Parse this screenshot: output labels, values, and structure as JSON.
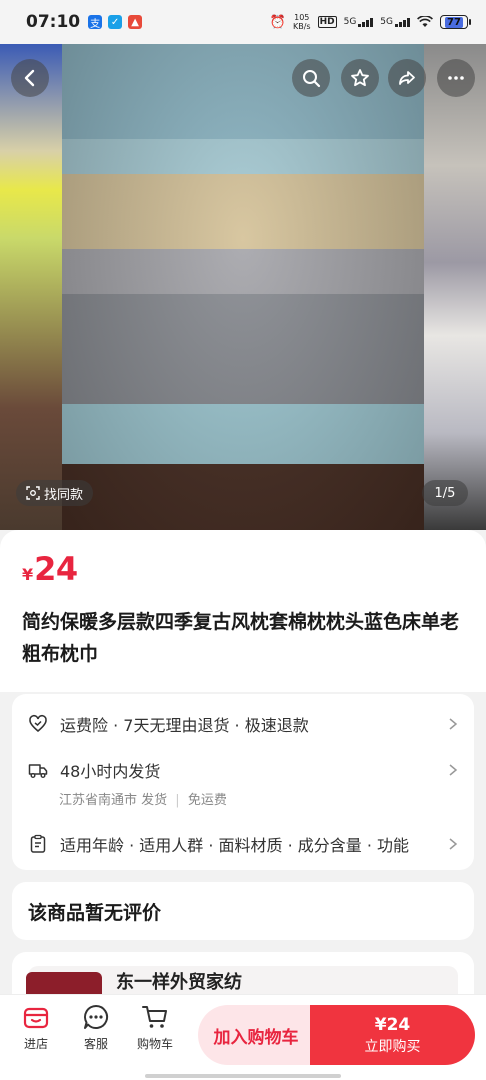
{
  "status_bar": {
    "time": "07:10",
    "speed_value": "105",
    "speed_unit": "KB/s",
    "hd_label": "HD",
    "signal1": "5G",
    "signal2": "5G",
    "battery": "77"
  },
  "gallery": {
    "find_similar_label": "找同款",
    "page_indicator": "1/5"
  },
  "product": {
    "currency": "¥",
    "price": "24",
    "title": "简约保暖多层款四季复古风枕套棉枕枕头蓝色床单老粗布枕巾"
  },
  "services": {
    "guarantee_text": "运费险 · 7天无理由退货 · 极速退款",
    "shipping_text": "48小时内发货",
    "shipping_origin": "江苏省南通市 发货",
    "shipping_fee": "免运费",
    "params_text": "适用年龄 · 适用人群 · 面料材质 · 成分含量 · 功能"
  },
  "reviews": {
    "empty_text": "该商品暂无评价"
  },
  "shop": {
    "name": "东一样外贸家纺"
  },
  "bottom_bar": {
    "shop_label": "进店",
    "service_label": "客服",
    "cart_label": "购物车",
    "add_to_cart": "加入购物车",
    "buy_price": "¥24",
    "buy_now": "立即购买"
  },
  "colors": {
    "accent": "#e8253f",
    "buy_button": "#f0343f",
    "cart_button_bg": "#fde5e8"
  }
}
